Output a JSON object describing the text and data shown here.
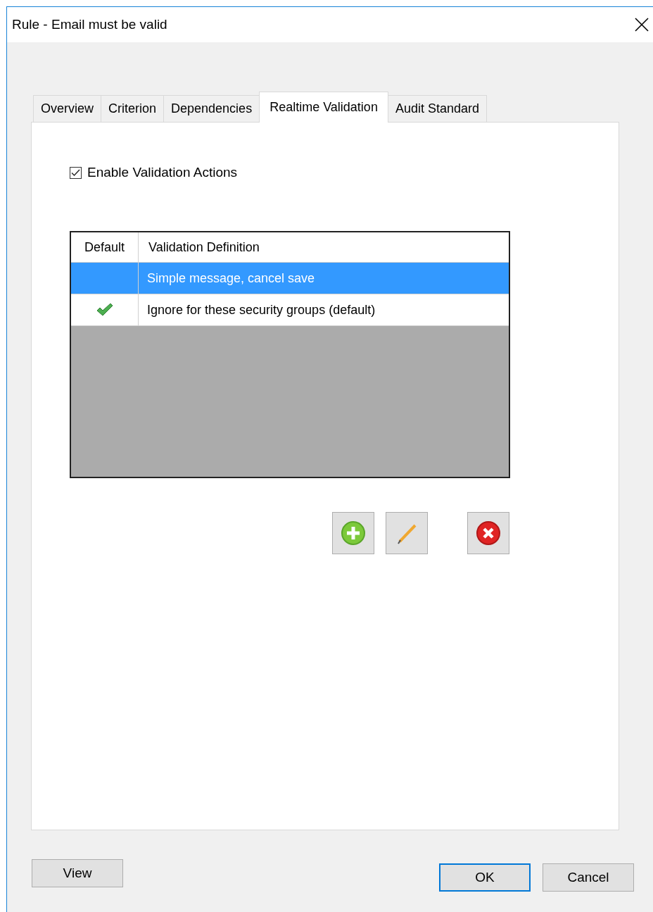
{
  "window": {
    "title": "Rule - Email must be valid"
  },
  "tabs": [
    {
      "label": "Overview",
      "selected": false
    },
    {
      "label": "Criterion",
      "selected": false
    },
    {
      "label": "Dependencies",
      "selected": false
    },
    {
      "label": "Realtime Validation",
      "selected": true
    },
    {
      "label": "Audit Standard",
      "selected": false
    }
  ],
  "enable_checkbox": {
    "label": "Enable Validation Actions",
    "checked": true
  },
  "table": {
    "columns": [
      "Default",
      "Validation Definition"
    ],
    "rows": [
      {
        "default": false,
        "definition": "Simple message, cancel save",
        "selected": true
      },
      {
        "default": true,
        "definition": "Ignore for these security groups (default)",
        "selected": false
      }
    ]
  },
  "footer": {
    "left_buttons": [
      {
        "label": "View",
        "default": false
      }
    ],
    "right_buttons": [
      {
        "label": "OK",
        "default": true
      },
      {
        "label": "Cancel",
        "default": false
      }
    ]
  }
}
